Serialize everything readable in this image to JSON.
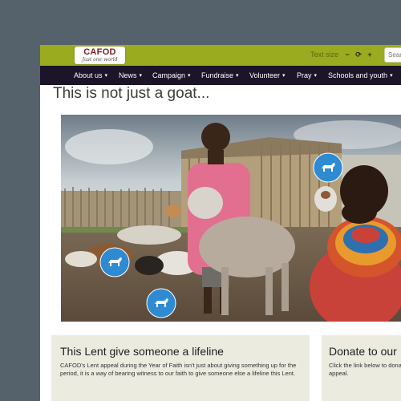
{
  "header": {
    "logo_main": "CAFOD",
    "logo_sub": "Just one world",
    "text_size_label": "Text size",
    "text_size_controls": [
      "−",
      "⟳",
      "+"
    ],
    "search_placeholder": "Search"
  },
  "nav": {
    "items": [
      {
        "label": "About us"
      },
      {
        "label": "News"
      },
      {
        "label": "Campaign"
      },
      {
        "label": "Fundraise"
      },
      {
        "label": "Volunteer"
      },
      {
        "label": "Pray"
      },
      {
        "label": "Schools and youth"
      }
    ],
    "caret": "▾"
  },
  "main": {
    "title": "This is not just a goat...",
    "hero_hotspots_icon": "goat-icon",
    "feature": {
      "title": "This Lent give someone a lifeline",
      "text": "CAFOD's Lent appeal during the Year of Faith isn't just about giving something up for the period, it is a way of bearing witness to our faith to give someone else a lifeline this Lent."
    },
    "donate": {
      "title": "Donate to our",
      "text": "Click the link below to donate to our Lent appeal."
    }
  },
  "colors": {
    "topbar": "#9aab20",
    "nav": "#1c1428",
    "hotspot": "#2e8bd2",
    "caption_bg": "#ecebe0"
  }
}
